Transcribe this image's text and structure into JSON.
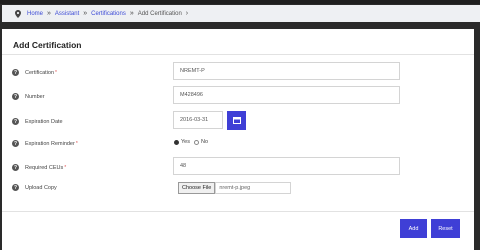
{
  "breadcrumb": {
    "items": [
      {
        "label": "Home",
        "link": true
      },
      {
        "label": "Assistant",
        "link": true
      },
      {
        "label": "Certifications",
        "link": true
      },
      {
        "label": "Add Certification",
        "link": false
      }
    ],
    "separator": "»",
    "trailing": "›"
  },
  "form": {
    "title": "Add Certification",
    "certification": {
      "label": "Certification",
      "required_mark": "*",
      "value": "NREMT-P"
    },
    "number": {
      "label": "Number",
      "value": "M428496"
    },
    "expiration_date": {
      "label": "Expiration Date",
      "value": "2016-03-31"
    },
    "expiration_reminder": {
      "label": "Expiration Reminder",
      "required_mark": "*",
      "yes_label": "Yes",
      "no_label": "No",
      "selected": "Yes"
    },
    "required_ceus": {
      "label": "Required CEUs",
      "required_mark": "*",
      "value": "48"
    },
    "upload_copy": {
      "label": "Upload Copy",
      "button_label": "Choose File",
      "file_name": "nremt-p.jpeg"
    }
  },
  "actions": {
    "add_label": "Add",
    "reset_label": "Reset"
  },
  "colors": {
    "accent": "#3f3fd6",
    "required": "#e05050"
  }
}
